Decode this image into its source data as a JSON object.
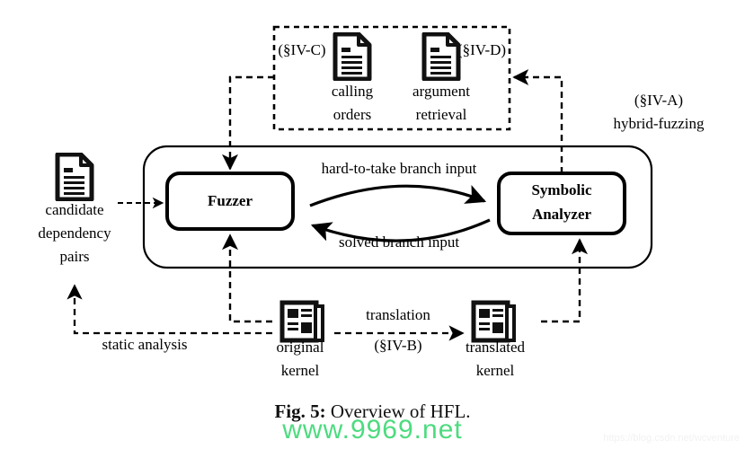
{
  "figure": {
    "caption_number": "Fig. 5:",
    "caption_text": " Overview of HFL."
  },
  "watermarks": {
    "center": "www.9969.net",
    "corner": "https://blog.csdn.net/wcventure",
    "center_color": "#4ddb7f",
    "corner_color": "#f2f2f2"
  },
  "diagram": {
    "type": "flow-diagram",
    "title": "Overview of HFL",
    "hybrid_container": {
      "section_tag": "(§IV-A)",
      "section_name": "hybrid-fuzzing",
      "nodes": [
        {
          "id": "fuzzer",
          "label": "Fuzzer"
        },
        {
          "id": "symbolic-analyzer",
          "label_line1": "Symbolic",
          "label_line2": "Analyzer"
        }
      ],
      "edges": [
        {
          "from": "fuzzer",
          "to": "symbolic-analyzer",
          "label": "hard-to-take branch input"
        },
        {
          "from": "symbolic-analyzer",
          "to": "fuzzer",
          "label": "solved branch input"
        }
      ]
    },
    "analysis_box": {
      "items": [
        {
          "id": "calling-orders",
          "section_tag": "(§IV-C)",
          "icon": "document-icon",
          "label_line1": "calling",
          "label_line2": "orders"
        },
        {
          "id": "argument-retrieval",
          "section_tag": "(§IV-D)",
          "icon": "document-icon",
          "label_line1": "argument",
          "label_line2": "retrieval"
        }
      ]
    },
    "artifacts": [
      {
        "id": "candidate-dependency-pairs",
        "icon": "document-icon",
        "label_line1": "candidate",
        "label_line2": "dependency",
        "label_line3": "pairs"
      },
      {
        "id": "original-kernel",
        "icon": "kernel-icon",
        "label_line1": "original",
        "label_line2": "kernel"
      },
      {
        "id": "translated-kernel",
        "icon": "kernel-icon",
        "label_line1": "translated",
        "label_line2": "kernel"
      }
    ],
    "process_labels": [
      {
        "id": "static-analysis",
        "label": "static analysis"
      },
      {
        "id": "translation",
        "label": "translation",
        "section_tag": "(§IV-B)"
      }
    ]
  }
}
